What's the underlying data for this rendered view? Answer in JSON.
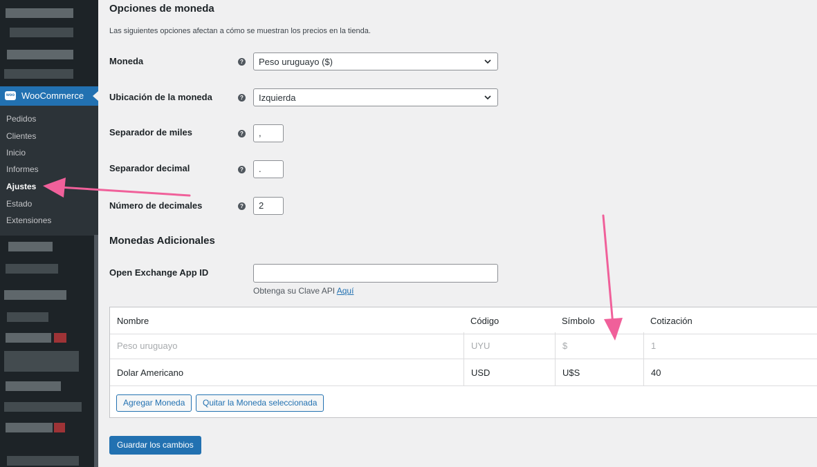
{
  "sidebar": {
    "woocommerce_label": "WooCommerce",
    "woo_logo_text": "woo",
    "submenu": [
      "Pedidos",
      "Clientes",
      "Inicio",
      "Informes",
      "Ajustes",
      "Estado",
      "Extensiones"
    ],
    "active_item": "Ajustes"
  },
  "main": {
    "currency_section_title": "Opciones de moneda",
    "currency_section_desc": "Las siguientes opciones afectan a cómo se muestran los precios en la tienda.",
    "currency": {
      "label": "Moneda",
      "value": "Peso uruguayo ($)"
    },
    "currency_position": {
      "label": "Ubicación de la moneda",
      "value": "Izquierda"
    },
    "thousand_separator": {
      "label": "Separador de miles",
      "value": ","
    },
    "decimal_separator": {
      "label": "Separador decimal",
      "value": "."
    },
    "num_decimals": {
      "label": "Número de decimales",
      "value": "2"
    },
    "additional_title": "Monedas Adicionales",
    "app_id": {
      "label": "Open Exchange App ID",
      "value": "",
      "note": "Obtenga su Clave API",
      "link": "Aquí"
    },
    "table": {
      "headers": [
        "Nombre",
        "Código",
        "Símbolo",
        "Cotización"
      ],
      "rows": [
        [
          "Peso uruguayo",
          "UYU",
          "$",
          "1"
        ],
        [
          "Dolar Americano",
          "USD",
          "U$S",
          "40"
        ]
      ]
    },
    "add_button": "Agregar Moneda",
    "remove_button": "Quitar la Moneda seleccionada",
    "save_button": "Guardar los cambios"
  },
  "colors": {
    "accent": "#2271b1",
    "annotation": "#f0609a",
    "sidebar_bg": "#1d2327"
  }
}
